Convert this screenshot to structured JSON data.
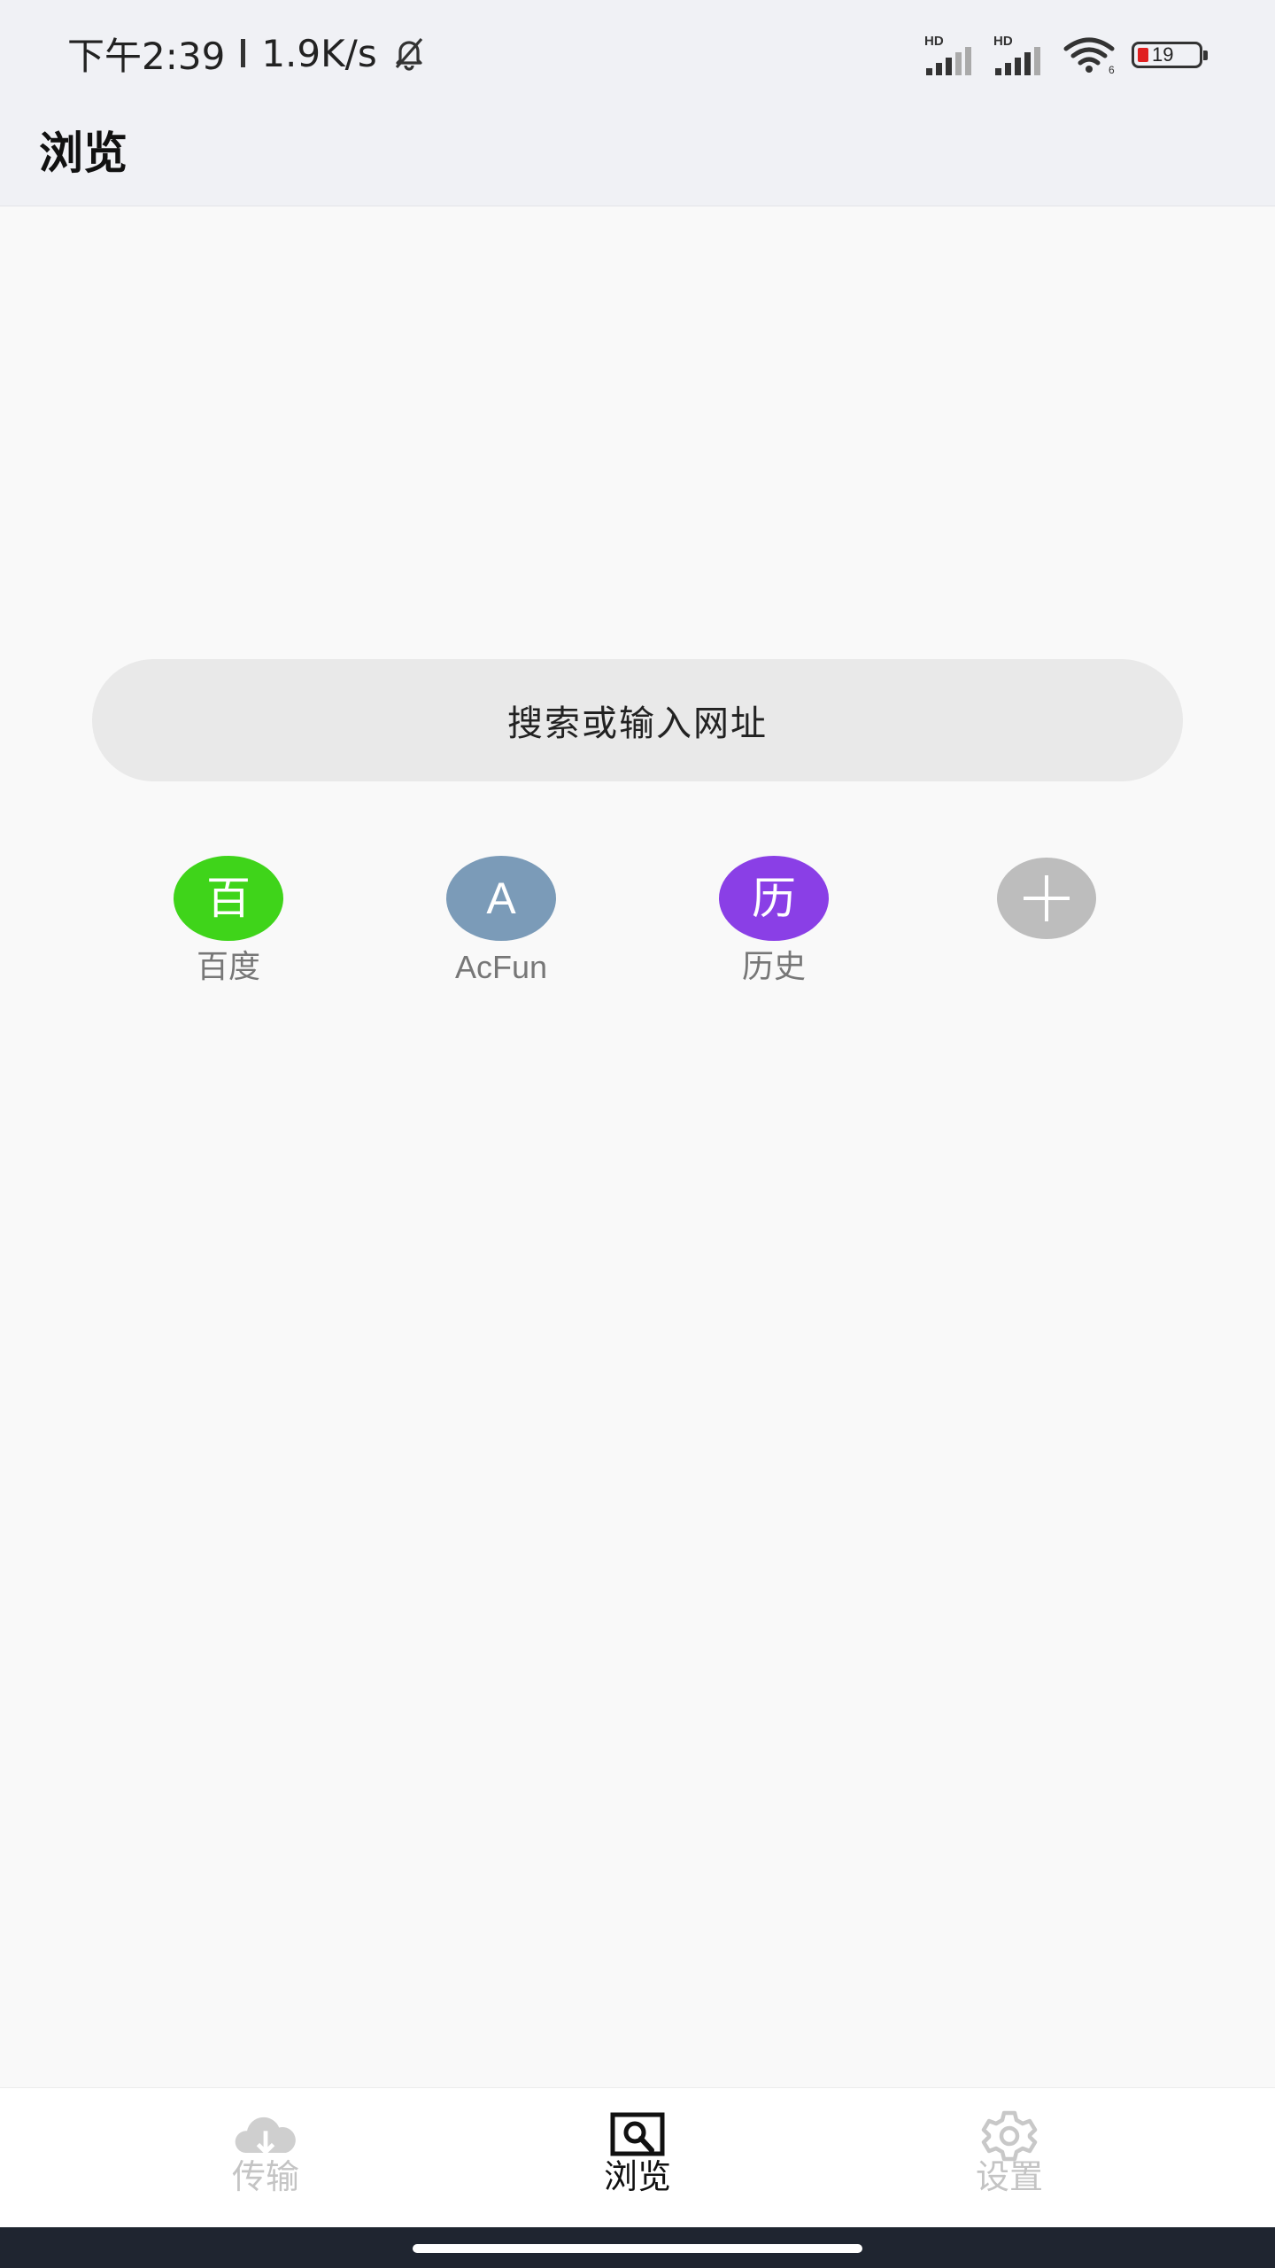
{
  "status_bar": {
    "time": "下午2:39",
    "net_speed": "1.9K/s",
    "mute_icon": "bell-slash-icon",
    "signal_1": "HD",
    "signal_2": "HD",
    "wifi_icon": "wifi-icon",
    "battery_level": "19",
    "battery_color": "#e02020"
  },
  "header": {
    "title": "浏览"
  },
  "search": {
    "placeholder": "搜索或输入网址"
  },
  "quick_links": [
    {
      "icon_text": "百",
      "label": "百度",
      "color": "#3fd41a"
    },
    {
      "icon_text": "A",
      "label": "AcFun",
      "color": "#7b9bb8"
    },
    {
      "icon_text": "历",
      "label": "历史",
      "color": "#8a3fe6"
    },
    {
      "icon_text": "",
      "label": "",
      "icon": "plus-icon",
      "color": "#bdbdbd"
    }
  ],
  "bottom_nav": {
    "items": [
      {
        "label": "传输",
        "icon": "cloud-download-icon",
        "active": false
      },
      {
        "label": "浏览",
        "icon": "browse-search-icon",
        "active": true
      },
      {
        "label": "设置",
        "icon": "gear-icon",
        "active": false
      }
    ],
    "active_color": "#111111",
    "inactive_color": "#c4c4c4"
  }
}
